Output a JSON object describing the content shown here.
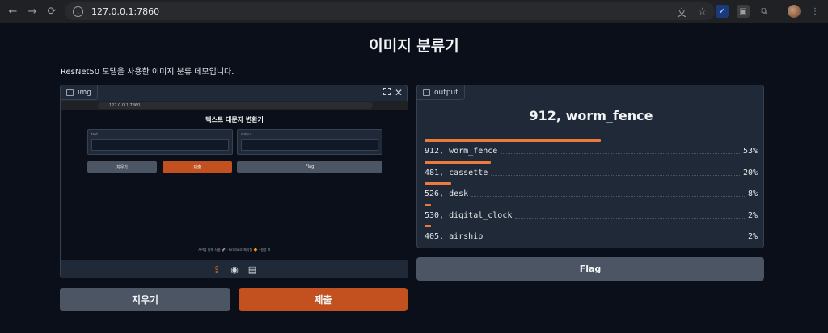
{
  "browser": {
    "url": "127.0.0.1:7860",
    "back_icon": "←",
    "forward_icon": "→",
    "reload_icon": "⟳",
    "star_icon": "☆",
    "translate_icon": "文"
  },
  "page": {
    "title": "이미지 분류기",
    "description": "ResNet50 모델을 사용한 이미지 분류 데모입니다."
  },
  "input_panel": {
    "label": "img",
    "screenshot": {
      "url": "127.0.0.1:7860",
      "title": "텍스트 대문자 변환기",
      "text_label": "text",
      "output_label": "output",
      "clear_label": "지우기",
      "submit_label": "제출",
      "flag_label": "Flag",
      "footer": "API를 통해 사용 🚀 · Gradio로 제작됨 🔶 · 설정 ⚙"
    },
    "toolbar": {
      "upload_icon": "⇪",
      "webcam_icon": "◉",
      "clipboard_icon": "▤"
    }
  },
  "output_panel": {
    "label": "output",
    "top_label": "912, worm_fence",
    "confidences": [
      {
        "label": "912, worm_fence",
        "pct": "53%",
        "value": 0.53
      },
      {
        "label": "481, cassette",
        "pct": "20%",
        "value": 0.2
      },
      {
        "label": "526, desk",
        "pct": "8%",
        "value": 0.08
      },
      {
        "label": "530, digital_clock",
        "pct": "2%",
        "value": 0.02
      },
      {
        "label": "405, airship",
        "pct": "2%",
        "value": 0.02
      }
    ],
    "bar_color": "#ea7b3c"
  },
  "buttons": {
    "clear": "지우기",
    "submit": "제출",
    "flag": "Flag"
  },
  "colors": {
    "background": "#0b0f19",
    "panel": "#1f2937",
    "submit": "#c2511f",
    "secondary": "#4b5563"
  }
}
